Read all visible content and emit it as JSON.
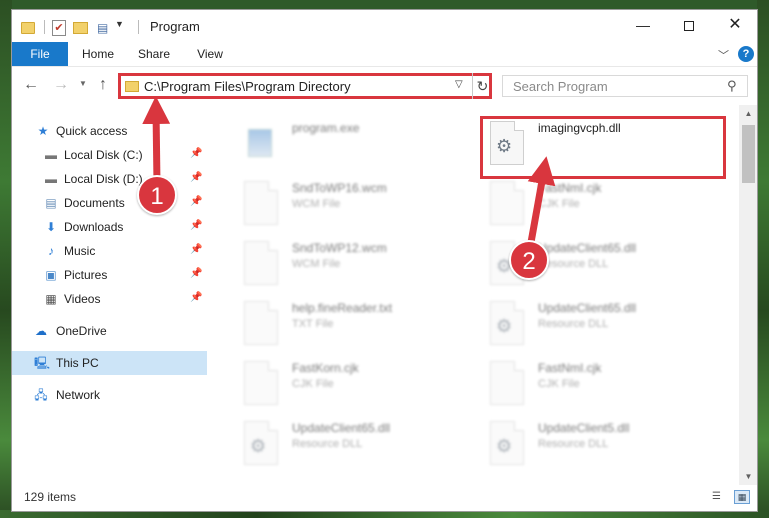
{
  "window": {
    "title": "Program",
    "minimize_glyph": "—",
    "close_glyph": "✕"
  },
  "ribbon": {
    "tabs": [
      {
        "label": "File"
      },
      {
        "label": "Home"
      },
      {
        "label": "Share"
      },
      {
        "label": "View"
      }
    ],
    "help_glyph": "?"
  },
  "nav": {
    "address": "C:\\Program Files\\Program Directory",
    "search_placeholder": "Search Program"
  },
  "sidebar": {
    "items": [
      {
        "label": "Quick access",
        "icon": "star-icon"
      },
      {
        "label": "Local Disk (C:)",
        "icon": "drive-icon",
        "pinned": true
      },
      {
        "label": "Local Disk (D:)",
        "icon": "drive-icon",
        "pinned": true
      },
      {
        "label": "Documents",
        "icon": "documents-icon",
        "pinned": true
      },
      {
        "label": "Downloads",
        "icon": "downloads-icon",
        "pinned": true
      },
      {
        "label": "Music",
        "icon": "music-icon",
        "pinned": true
      },
      {
        "label": "Pictures",
        "icon": "pictures-icon",
        "pinned": true
      },
      {
        "label": "Videos",
        "icon": "videos-icon",
        "pinned": true
      },
      {
        "label": "OneDrive",
        "icon": "cloud-icon"
      },
      {
        "label": "This PC",
        "icon": "computer-icon",
        "selected": true
      },
      {
        "label": "Network",
        "icon": "network-icon"
      }
    ]
  },
  "files": [
    {
      "name": "program.exe",
      "type": "",
      "icon": "exe-icon"
    },
    {
      "name": "imagingvcph.dll",
      "type": "",
      "icon": "dll-icon",
      "highlighted": true
    },
    {
      "name": "SndToWP16.wcm",
      "type": "WCM File",
      "icon": "file-icon"
    },
    {
      "name": "FastNmI.cjk",
      "type": "CJK File",
      "icon": "file-icon"
    },
    {
      "name": "SndToWP12.wcm",
      "type": "WCM File",
      "icon": "file-icon"
    },
    {
      "name": "UpdateClient65.dll",
      "type": "Resource DLL",
      "icon": "dll-icon"
    },
    {
      "name": "help.fineReader.txt",
      "type": "TXT File",
      "icon": "file-icon"
    },
    {
      "name": "UpdateClient65.dll",
      "type": "Resource DLL",
      "icon": "dll-icon"
    },
    {
      "name": "FastKorn.cjk",
      "type": "CJK File",
      "icon": "file-icon"
    },
    {
      "name": "FastNmI.cjk",
      "type": "CJK File",
      "icon": "file-icon"
    },
    {
      "name": "UpdateClient65.dll",
      "type": "Resource DLL",
      "icon": "dll-icon"
    },
    {
      "name": "UpdateClient5.dll",
      "type": "Resource DLL",
      "icon": "dll-icon"
    }
  ],
  "status": {
    "item_count": "129 items"
  },
  "annotations": {
    "step_1": "1",
    "step_2": "2"
  },
  "colors": {
    "accent": "#1979ca",
    "annotation_red": "#d9363e",
    "selected_bg": "#cce4f7"
  }
}
